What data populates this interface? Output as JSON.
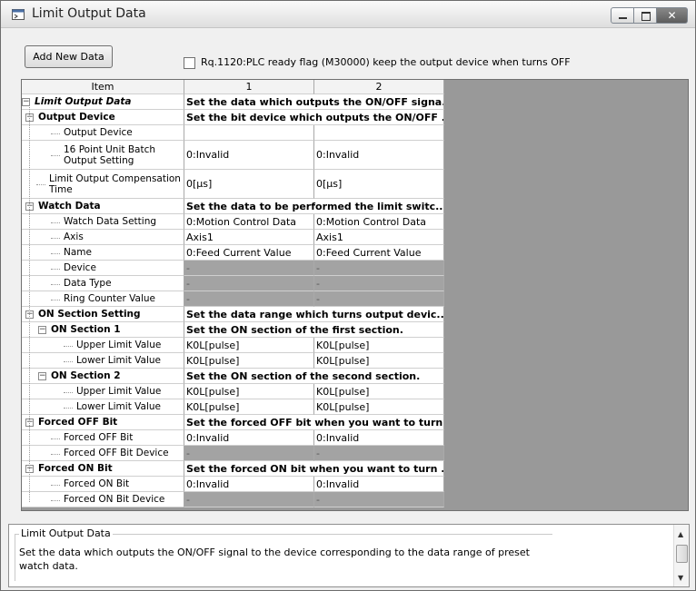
{
  "window": {
    "title": "Limit Output Data",
    "close_glyph": "✕"
  },
  "toolbar": {
    "add_label": "Add New Data",
    "checkbox_label": "Rq.1120:PLC ready flag (M30000) keep the output device when turns OFF",
    "checkbox_checked": false
  },
  "grid": {
    "columns": [
      "Item",
      "1",
      "2"
    ],
    "rows": [
      {
        "label": "Limit Output Data",
        "style": "bi",
        "merged": "Set the data which outputs the ON/OFF signa..."
      },
      {
        "label": "Output Device",
        "style": "b",
        "merged": "Set the bit device which outputs the ON/OFF ..."
      },
      {
        "label": "Output Device",
        "v1": "",
        "v2": ""
      },
      {
        "label": "16 Point Unit Batch Output Setting",
        "v1": "0:Invalid",
        "v2": "0:Invalid"
      },
      {
        "label": "Limit Output Compensation Time",
        "v1": "0[µs]",
        "v2": "0[µs]"
      },
      {
        "label": "Watch Data",
        "style": "b",
        "merged": "Set the data to be performed the limit switc..."
      },
      {
        "label": "Watch Data Setting",
        "v1": "0:Motion Control Data",
        "v2": "0:Motion Control Data"
      },
      {
        "label": "Axis",
        "v1": "Axis1",
        "v2": "Axis1"
      },
      {
        "label": "Name",
        "v1": "0:Feed Current Value",
        "v2": "0:Feed Current Value"
      },
      {
        "label": "Device",
        "v1": "-",
        "v2": "-",
        "gray": true
      },
      {
        "label": "Data Type",
        "v1": "-",
        "v2": "-",
        "gray": true
      },
      {
        "label": "Ring Counter Value",
        "v1": "-",
        "v2": "-",
        "gray": true
      },
      {
        "label": "ON Section Setting",
        "style": "b",
        "merged": "Set the data range which turns output devic..."
      },
      {
        "label": "ON Section 1",
        "style": "b",
        "merged": "Set the ON section of the first section."
      },
      {
        "label": "Upper Limit Value",
        "v1": "K0L[pulse]",
        "v2": "K0L[pulse]"
      },
      {
        "label": "Lower Limit Value",
        "v1": "K0L[pulse]",
        "v2": "K0L[pulse]"
      },
      {
        "label": "ON Section 2",
        "style": "b",
        "merged": "Set the ON section of the second section."
      },
      {
        "label": "Upper Limit Value",
        "v1": "K0L[pulse]",
        "v2": "K0L[pulse]"
      },
      {
        "label": "Lower Limit Value",
        "v1": "K0L[pulse]",
        "v2": "K0L[pulse]"
      },
      {
        "label": "Forced OFF Bit",
        "style": "b",
        "merged": "Set the forced OFF bit when you want to turn..."
      },
      {
        "label": "Forced OFF Bit",
        "v1": "0:Invalid",
        "v2": "0:Invalid"
      },
      {
        "label": "Forced OFF Bit Device",
        "v1": "-",
        "v2": "-",
        "gray": true
      },
      {
        "label": "Forced ON Bit",
        "style": "b",
        "merged": "Set the forced ON bit when you want to turn ..."
      },
      {
        "label": "Forced ON Bit",
        "v1": "0:Invalid",
        "v2": "0:Invalid"
      },
      {
        "label": "Forced ON Bit Device",
        "v1": "-",
        "v2": "-",
        "gray": true
      }
    ]
  },
  "description": {
    "title": "Limit Output Data",
    "text": "Set the data which outputs the ON/OFF signal to the device corresponding to the data range of preset watch data."
  },
  "scrollbar": {
    "up_glyph": "▲",
    "down_glyph": "▼"
  }
}
